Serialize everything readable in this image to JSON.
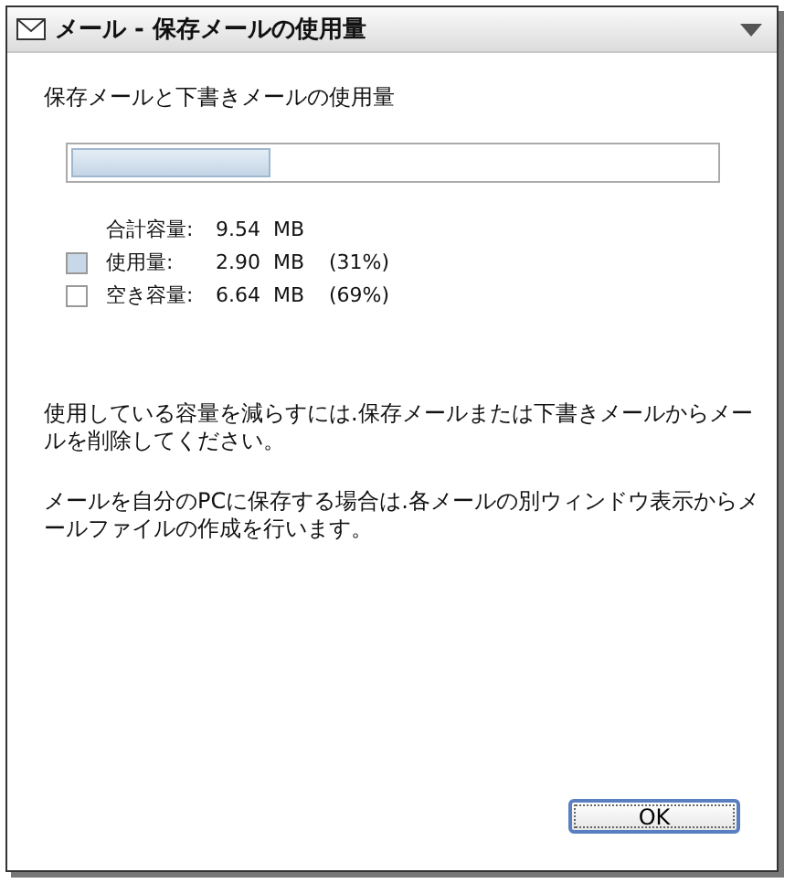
{
  "window": {
    "title": "メール - 保存メールの使用量"
  },
  "heading": "保存メールと下書きメールの使用量",
  "usage_bar": {
    "level": 0.31
  },
  "legend": [
    {
      "kind": "total",
      "label": "合計容量:",
      "value": "9.54  MB"
    },
    {
      "kind": "swatch",
      "label": "使用量:",
      "value": "2.90  MB",
      "percent": "(31%)",
      "color": "#c9d8e8"
    },
    {
      "kind": "swatch",
      "label": "空き容量:",
      "value": "6.64  MB",
      "percent": "(69%)",
      "color": "#ffffff"
    }
  ],
  "paragraphs": [
    "使用している容量を減らすには.保存メールまたは下書きメールからメールを削除してください。",
    "メールを自分のPCに保存する場合は.各メールの別ウィンドウ表示からメールファイルの作成を行います。"
  ],
  "buttons": [
    {
      "label": "OK"
    }
  ]
}
